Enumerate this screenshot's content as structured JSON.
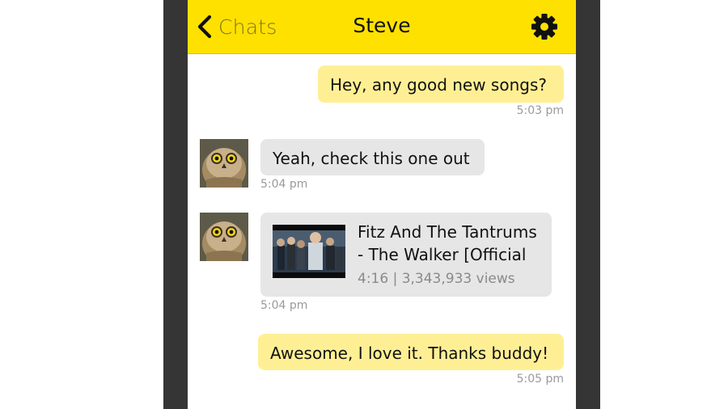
{
  "nav": {
    "back_label": "Chats",
    "title": "Steve",
    "back_icon": "chevron-left-icon",
    "settings_icon": "gear-icon"
  },
  "messages": [
    {
      "sender": "me",
      "text": "Hey, any good new songs?",
      "time": "5:03 pm"
    },
    {
      "sender": "Steve",
      "text": "Yeah, check this one out",
      "time": "5:04 pm"
    },
    {
      "sender": "Steve",
      "video": {
        "title": "Fitz And The Tantrums - The Walker [Official",
        "meta": "4:16 | 3,343,933 views"
      },
      "time": "5:04 pm"
    },
    {
      "sender": "me",
      "text": "Awesome, I love it. Thanks buddy!",
      "time": "5:05 pm"
    }
  ],
  "colors": {
    "nav_bg": "#ffe100",
    "my_bubble": "#ffef94",
    "their_bubble": "#e6e6e6",
    "bezel": "#353535",
    "timestamp": "#9a9a9a"
  }
}
